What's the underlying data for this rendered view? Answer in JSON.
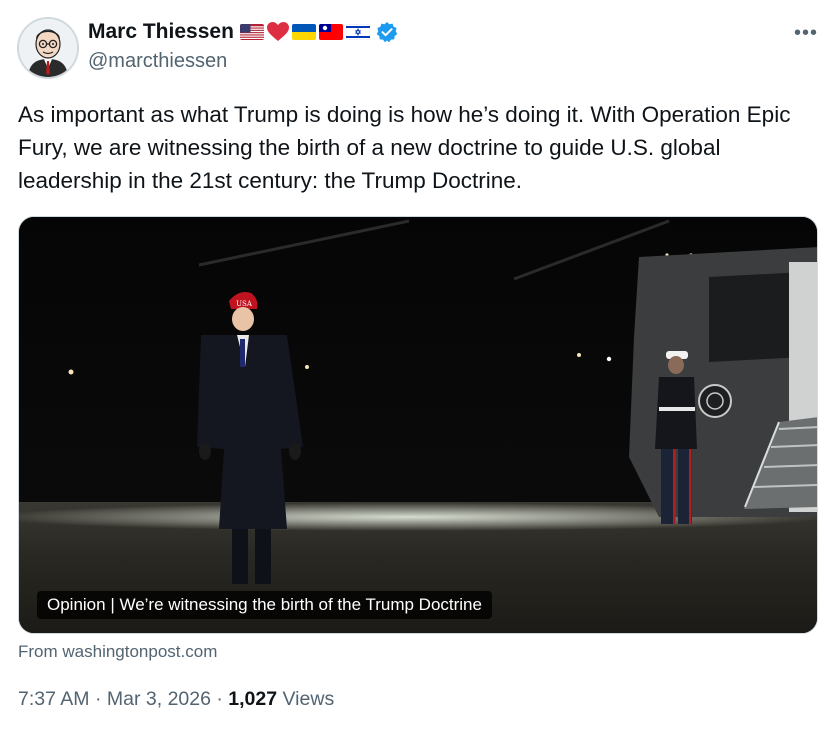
{
  "author": {
    "display_name": "Marc Thiessen",
    "handle": "@marcthiessen",
    "name_emojis": [
      "us-flag",
      "red-heart",
      "ukraine-flag",
      "taiwan-flag",
      "israel-flag"
    ],
    "verified_icon": "verified-badge-icon",
    "verified_color": "#1d9bf0"
  },
  "more_icon": "more-options-icon",
  "tweet": {
    "text": "As important as what Trump is doing is how he’s doing it. With Operation Epic Fury, we are witnessing the birth of a new doctrine to guide U.S. global leadership in the 21st century: the Trump Doctrine."
  },
  "link_card": {
    "caption": "Opinion | We’re witnessing the birth of the Trump Doctrine",
    "source": "From washingtonpost.com",
    "hat_text": "USA"
  },
  "meta": {
    "time": "7:37 AM",
    "separator": "·",
    "date": "Mar 3, 2026",
    "views_count": "1,027",
    "views_label": "Views"
  }
}
